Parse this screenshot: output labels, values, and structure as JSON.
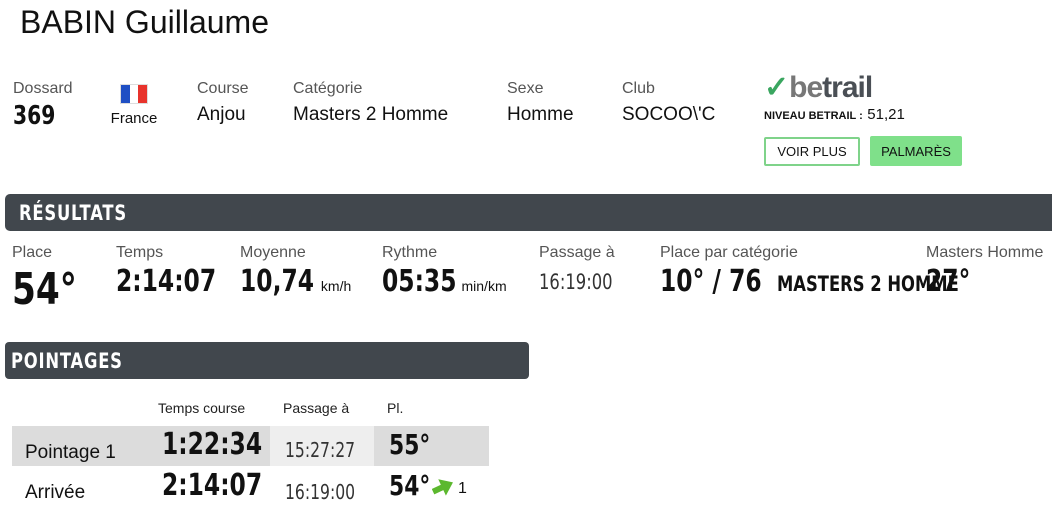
{
  "athlete": {
    "name": "BABIN Guillaume"
  },
  "info": {
    "bib_label": "Dossard",
    "bib_value": "369",
    "country": "France",
    "flag_colors": [
      "#1f4fc4",
      "#ffffff",
      "#e8332c"
    ],
    "race_label": "Course",
    "race_value": "Anjou",
    "category_label": "Catégorie",
    "category_value": "Masters 2 Homme",
    "sex_label": "Sexe",
    "sex_value": "Homme",
    "club_label": "Club",
    "club_value": "SOCOO\\'C"
  },
  "betrail": {
    "logo_be": "be",
    "logo_trail": "trail",
    "level_label": "NIVEAU BETRAIL :",
    "level_value": "51,21",
    "see_more": "VOIR PLUS",
    "palmares": "PALMARÈS"
  },
  "results": {
    "title": "RÉSULTATS",
    "place_label": "Place",
    "place_value": "54°",
    "time_label": "Temps",
    "time_value": "2:14:07",
    "avg_label": "Moyenne",
    "avg_value": "10,74",
    "avg_unit": "km/h",
    "pace_label": "Rythme",
    "pace_value": "05:35",
    "pace_unit": "min/km",
    "passage_label": "Passage à",
    "passage_value": "16:19:00",
    "cat_place_label": "Place par catégorie",
    "cat_place_value": "10° / 76",
    "cat_place_name": "MASTERS 2 HOMME",
    "masters_label": "Masters Homme",
    "masters_value": "27°"
  },
  "checkpoints": {
    "title": "POINTAGES",
    "headers": {
      "time": "Temps course",
      "passage": "Passage à",
      "place": "Pl."
    },
    "rows": [
      {
        "name": "Pointage 1",
        "time": "1:22:34",
        "passage": "15:27:27",
        "place": "55°"
      },
      {
        "name": "Arrivée",
        "time": "2:14:07",
        "passage": "16:19:00",
        "place": "54°",
        "gain": "1"
      }
    ]
  }
}
